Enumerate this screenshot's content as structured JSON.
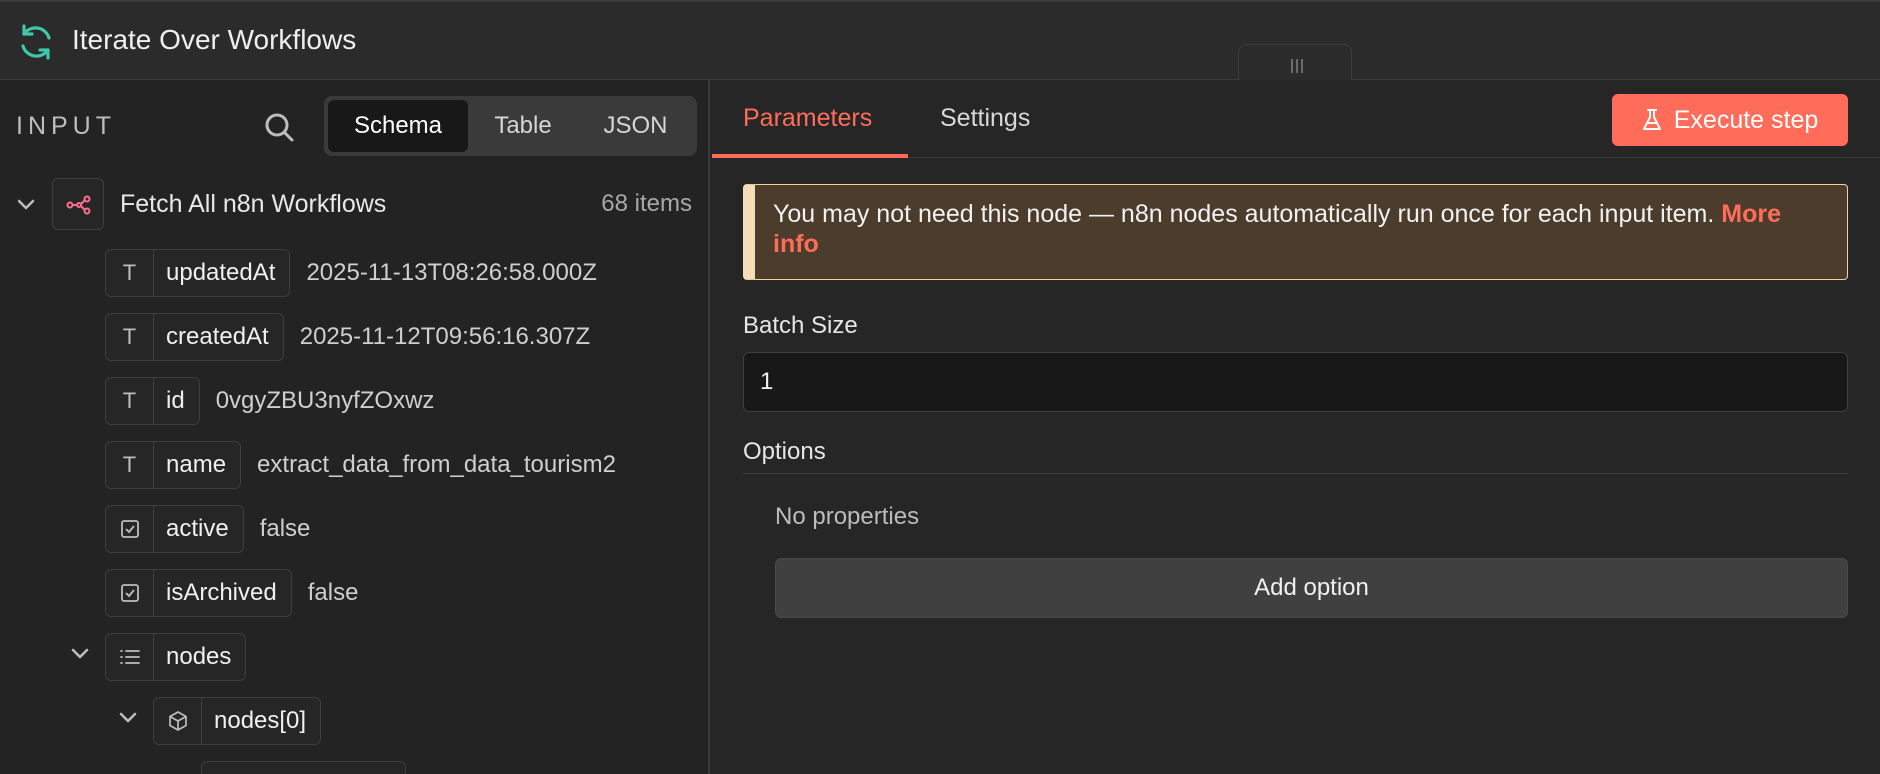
{
  "header": {
    "title": "Iterate Over Workflows"
  },
  "input_panel": {
    "label": "INPUT",
    "view_tabs": [
      "Schema",
      "Table",
      "JSON"
    ],
    "active_view": "Schema",
    "node": {
      "name": "Fetch All n8n Workflows",
      "count": "68 items"
    },
    "fields": [
      {
        "type": "string",
        "key": "updatedAt",
        "value": "2025-11-13T08:26:58.000Z"
      },
      {
        "type": "string",
        "key": "createdAt",
        "value": "2025-11-12T09:56:16.307Z"
      },
      {
        "type": "string",
        "key": "id",
        "value": "0vgyZBU3nyfZOxwz"
      },
      {
        "type": "string",
        "key": "name",
        "value": "extract_data_from_data_tourism2"
      },
      {
        "type": "boolean",
        "key": "active",
        "value": "false"
      },
      {
        "type": "boolean",
        "key": "isArchived",
        "value": "false"
      },
      {
        "type": "array",
        "key": "nodes",
        "value": ""
      },
      {
        "type": "object",
        "key": "nodes[0]",
        "value": ""
      }
    ]
  },
  "params_panel": {
    "tabs": [
      "Parameters",
      "Settings"
    ],
    "active_tab": "Parameters",
    "execute_label": "Execute step",
    "notice_text": "You may not need this node — n8n nodes automatically run once for each input item. ",
    "notice_link": "More info",
    "batch_size_label": "Batch Size",
    "batch_size_value": "1",
    "options_label": "Options",
    "no_properties": "No properties",
    "add_option_label": "Add option"
  },
  "colors": {
    "accent": "#ff6d5a",
    "logo": "#3ec7a8",
    "notice_bg": "#4b3c2b"
  }
}
